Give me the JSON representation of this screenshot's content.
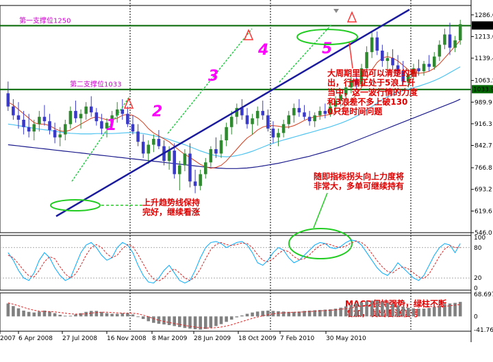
{
  "chart_data": {
    "type": "candlestick",
    "x_ticks": [
      "2007",
      "6 Apr 2008",
      "27 Jul 2008",
      "16 Nov 2008",
      "8 Mar 2009",
      "28 Jun 2009",
      "18 Oct 2009",
      "7 Feb 2010",
      "30 May 2010"
    ],
    "price_ticks": [
      "1286.6",
      "1213.0",
      "1139.4",
      "1063.5",
      "989.9",
      "916.3",
      "842.7",
      "766.8",
      "693.2",
      "619.6",
      "546.0"
    ],
    "price_range": [
      546.0,
      1300.0
    ],
    "current_price_tag": "1250.6",
    "support_price_tag": "1033.9",
    "support_lines": [
      {
        "label": "第一支撑位1250",
        "value": 1250
      },
      {
        "label": "第二支撑位1033",
        "value": 1033
      }
    ],
    "wave_labels": [
      "1",
      "2",
      "3",
      "4",
      "5"
    ],
    "series": [
      {
        "x": 0,
        "o": 1020,
        "h": 1060,
        "l": 960,
        "c": 975
      },
      {
        "x": 1,
        "o": 975,
        "h": 1000,
        "l": 930,
        "c": 945
      },
      {
        "x": 2,
        "o": 945,
        "h": 990,
        "l": 900,
        "c": 930
      },
      {
        "x": 3,
        "o": 930,
        "h": 960,
        "l": 880,
        "c": 905
      },
      {
        "x": 4,
        "o": 905,
        "h": 950,
        "l": 870,
        "c": 890
      },
      {
        "x": 5,
        "o": 890,
        "h": 930,
        "l": 860,
        "c": 915
      },
      {
        "x": 6,
        "o": 915,
        "h": 960,
        "l": 890,
        "c": 940
      },
      {
        "x": 7,
        "o": 940,
        "h": 980,
        "l": 910,
        "c": 925
      },
      {
        "x": 8,
        "o": 925,
        "h": 950,
        "l": 880,
        "c": 895
      },
      {
        "x": 9,
        "o": 895,
        "h": 920,
        "l": 850,
        "c": 870
      },
      {
        "x": 10,
        "o": 870,
        "h": 905,
        "l": 840,
        "c": 880
      },
      {
        "x": 11,
        "o": 880,
        "h": 930,
        "l": 860,
        "c": 915
      },
      {
        "x": 12,
        "o": 915,
        "h": 975,
        "l": 900,
        "c": 960
      },
      {
        "x": 13,
        "o": 960,
        "h": 995,
        "l": 920,
        "c": 935
      },
      {
        "x": 14,
        "o": 935,
        "h": 965,
        "l": 900,
        "c": 950
      },
      {
        "x": 15,
        "o": 950,
        "h": 990,
        "l": 930,
        "c": 975
      },
      {
        "x": 16,
        "o": 975,
        "h": 1010,
        "l": 940,
        "c": 955
      },
      {
        "x": 17,
        "o": 955,
        "h": 970,
        "l": 910,
        "c": 925
      },
      {
        "x": 18,
        "o": 925,
        "h": 950,
        "l": 880,
        "c": 900
      },
      {
        "x": 19,
        "o": 900,
        "h": 935,
        "l": 870,
        "c": 920
      },
      {
        "x": 20,
        "o": 920,
        "h": 960,
        "l": 900,
        "c": 945
      },
      {
        "x": 21,
        "o": 945,
        "h": 990,
        "l": 920,
        "c": 965
      },
      {
        "x": 22,
        "o": 965,
        "h": 1000,
        "l": 930,
        "c": 950
      },
      {
        "x": 23,
        "o": 950,
        "h": 975,
        "l": 905,
        "c": 915
      },
      {
        "x": 24,
        "o": 915,
        "h": 945,
        "l": 880,
        "c": 890
      },
      {
        "x": 25,
        "o": 890,
        "h": 915,
        "l": 840,
        "c": 855
      },
      {
        "x": 26,
        "o": 855,
        "h": 880,
        "l": 800,
        "c": 815
      },
      {
        "x": 27,
        "o": 815,
        "h": 860,
        "l": 780,
        "c": 845
      },
      {
        "x": 28,
        "o": 845,
        "h": 880,
        "l": 820,
        "c": 865
      },
      {
        "x": 29,
        "o": 865,
        "h": 895,
        "l": 830,
        "c": 840
      },
      {
        "x": 30,
        "o": 840,
        "h": 860,
        "l": 775,
        "c": 790
      },
      {
        "x": 31,
        "o": 790,
        "h": 840,
        "l": 760,
        "c": 825
      },
      {
        "x": 32,
        "o": 825,
        "h": 850,
        "l": 730,
        "c": 745
      },
      {
        "x": 33,
        "o": 745,
        "h": 790,
        "l": 690,
        "c": 775
      },
      {
        "x": 34,
        "o": 775,
        "h": 830,
        "l": 755,
        "c": 815
      },
      {
        "x": 35,
        "o": 815,
        "h": 850,
        "l": 700,
        "c": 720
      },
      {
        "x": 36,
        "o": 720,
        "h": 760,
        "l": 680,
        "c": 705
      },
      {
        "x": 37,
        "o": 705,
        "h": 760,
        "l": 690,
        "c": 745
      },
      {
        "x": 38,
        "o": 745,
        "h": 800,
        "l": 730,
        "c": 785
      },
      {
        "x": 39,
        "o": 785,
        "h": 840,
        "l": 770,
        "c": 830
      },
      {
        "x": 40,
        "o": 830,
        "h": 870,
        "l": 800,
        "c": 815
      },
      {
        "x": 41,
        "o": 815,
        "h": 880,
        "l": 800,
        "c": 860
      },
      {
        "x": 42,
        "o": 860,
        "h": 920,
        "l": 840,
        "c": 905
      },
      {
        "x": 43,
        "o": 905,
        "h": 960,
        "l": 880,
        "c": 940
      },
      {
        "x": 44,
        "o": 940,
        "h": 985,
        "l": 915,
        "c": 970
      },
      {
        "x": 45,
        "o": 970,
        "h": 1000,
        "l": 930,
        "c": 945
      },
      {
        "x": 46,
        "o": 945,
        "h": 970,
        "l": 900,
        "c": 915
      },
      {
        "x": 47,
        "o": 915,
        "h": 950,
        "l": 880,
        "c": 935
      },
      {
        "x": 48,
        "o": 935,
        "h": 975,
        "l": 910,
        "c": 960
      },
      {
        "x": 49,
        "o": 960,
        "h": 995,
        "l": 930,
        "c": 945
      },
      {
        "x": 50,
        "o": 945,
        "h": 965,
        "l": 890,
        "c": 900
      },
      {
        "x": 51,
        "o": 900,
        "h": 925,
        "l": 850,
        "c": 870
      },
      {
        "x": 52,
        "o": 870,
        "h": 900,
        "l": 840,
        "c": 885
      },
      {
        "x": 53,
        "o": 885,
        "h": 930,
        "l": 870,
        "c": 915
      },
      {
        "x": 54,
        "o": 915,
        "h": 960,
        "l": 900,
        "c": 945
      },
      {
        "x": 55,
        "o": 945,
        "h": 985,
        "l": 920,
        "c": 970
      },
      {
        "x": 56,
        "o": 970,
        "h": 1000,
        "l": 940,
        "c": 955
      },
      {
        "x": 57,
        "o": 955,
        "h": 980,
        "l": 930,
        "c": 940
      },
      {
        "x": 58,
        "o": 940,
        "h": 960,
        "l": 910,
        "c": 925
      },
      {
        "x": 59,
        "o": 925,
        "h": 955,
        "l": 905,
        "c": 945
      },
      {
        "x": 60,
        "o": 945,
        "h": 975,
        "l": 930,
        "c": 960
      },
      {
        "x": 61,
        "o": 960,
        "h": 985,
        "l": 935,
        "c": 950
      },
      {
        "x": 62,
        "o": 950,
        "h": 990,
        "l": 940,
        "c": 975
      },
      {
        "x": 63,
        "o": 975,
        "h": 1010,
        "l": 955,
        "c": 995
      },
      {
        "x": 64,
        "o": 995,
        "h": 1030,
        "l": 975,
        "c": 1015
      },
      {
        "x": 65,
        "o": 1015,
        "h": 1050,
        "l": 995,
        "c": 1040
      },
      {
        "x": 66,
        "o": 1040,
        "h": 1080,
        "l": 1020,
        "c": 1065
      },
      {
        "x": 67,
        "o": 1065,
        "h": 1090,
        "l": 1030,
        "c": 1050
      },
      {
        "x": 68,
        "o": 1050,
        "h": 1120,
        "l": 1040,
        "c": 1105
      },
      {
        "x": 69,
        "o": 1105,
        "h": 1180,
        "l": 1090,
        "c": 1160
      },
      {
        "x": 70,
        "o": 1160,
        "h": 1230,
        "l": 1140,
        "c": 1210
      },
      {
        "x": 71,
        "o": 1210,
        "h": 1230,
        "l": 1150,
        "c": 1165
      },
      {
        "x": 72,
        "o": 1165,
        "h": 1185,
        "l": 1110,
        "c": 1130
      },
      {
        "x": 73,
        "o": 1130,
        "h": 1160,
        "l": 1090,
        "c": 1140
      },
      {
        "x": 74,
        "o": 1140,
        "h": 1170,
        "l": 1100,
        "c": 1115
      },
      {
        "x": 75,
        "o": 1115,
        "h": 1150,
        "l": 1080,
        "c": 1095
      },
      {
        "x": 76,
        "o": 1095,
        "h": 1130,
        "l": 1050,
        "c": 1060
      },
      {
        "x": 77,
        "o": 1060,
        "h": 1100,
        "l": 1040,
        "c": 1085
      },
      {
        "x": 78,
        "o": 1085,
        "h": 1120,
        "l": 1065,
        "c": 1105
      },
      {
        "x": 79,
        "o": 1105,
        "h": 1135,
        "l": 1080,
        "c": 1095
      },
      {
        "x": 80,
        "o": 1095,
        "h": 1130,
        "l": 1080,
        "c": 1120
      },
      {
        "x": 81,
        "o": 1120,
        "h": 1150,
        "l": 1095,
        "c": 1110
      },
      {
        "x": 82,
        "o": 1110,
        "h": 1160,
        "l": 1100,
        "c": 1145
      },
      {
        "x": 83,
        "o": 1145,
        "h": 1200,
        "l": 1130,
        "c": 1185
      },
      {
        "x": 84,
        "o": 1185,
        "h": 1240,
        "l": 1170,
        "c": 1220
      },
      {
        "x": 85,
        "o": 1220,
        "h": 1260,
        "l": 1150,
        "c": 1175
      },
      {
        "x": 86,
        "o": 1175,
        "h": 1215,
        "l": 1160,
        "c": 1200
      },
      {
        "x": 87,
        "o": 1200,
        "h": 1270,
        "l": 1185,
        "c": 1255
      }
    ],
    "ma_short": [
      990,
      980,
      965,
      950,
      935,
      920,
      915,
      915,
      910,
      900,
      892,
      890,
      895,
      905,
      915,
      925,
      935,
      940,
      935,
      930,
      930,
      935,
      945,
      948,
      945,
      935,
      920,
      900,
      885,
      875,
      865,
      855,
      840,
      825,
      812,
      802,
      790,
      778,
      770,
      765,
      768,
      775,
      790,
      810,
      830,
      850,
      868,
      880,
      895,
      905,
      910,
      910,
      908,
      905,
      905,
      910,
      918,
      928,
      935,
      940,
      942,
      945,
      948,
      955,
      965,
      978,
      995,
      1015,
      1040,
      1070,
      1100,
      1125,
      1140,
      1145,
      1140,
      1130,
      1115,
      1100,
      1090,
      1088,
      1090,
      1095,
      1105,
      1120,
      1140,
      1160,
      1180,
      1200
    ],
    "ma_mid": [
      915,
      913,
      910,
      907,
      904,
      901,
      898,
      896,
      894,
      891,
      888,
      886,
      884,
      883,
      882,
      882,
      882,
      883,
      883,
      883,
      883,
      884,
      885,
      886,
      886,
      885,
      883,
      880,
      876,
      872,
      868,
      863,
      857,
      851,
      845,
      838,
      831,
      824,
      818,
      812,
      808,
      805,
      804,
      805,
      808,
      812,
      817,
      823,
      830,
      837,
      844,
      850,
      856,
      861,
      866,
      871,
      876,
      881,
      886,
      891,
      896,
      901,
      906,
      912,
      918,
      925,
      933,
      942,
      952,
      963,
      975,
      987,
      998,
      1008,
      1016,
      1023,
      1029,
      1034,
      1039,
      1044,
      1050,
      1056,
      1063,
      1071,
      1080,
      1090,
      1100,
      1110
    ],
    "ma_long": [
      845,
      843,
      841,
      839,
      837,
      835,
      833,
      831,
      829,
      827,
      825,
      823,
      821,
      819,
      817,
      815,
      813,
      811,
      809,
      807,
      805,
      803,
      801,
      799,
      797,
      795,
      793,
      791,
      789,
      787,
      785,
      783,
      781,
      779,
      777,
      775,
      773,
      771,
      769,
      767,
      766,
      765,
      764,
      764,
      764,
      765,
      766,
      768,
      770,
      773,
      776,
      779,
      782,
      786,
      790,
      794,
      798,
      802,
      806,
      811,
      816,
      821,
      826,
      832,
      838,
      845,
      852,
      859,
      866,
      873,
      880,
      887,
      894,
      901,
      908,
      915,
      922,
      929,
      936,
      943,
      950,
      957,
      964,
      971,
      978,
      985,
      992,
      1000
    ],
    "stoch_ticks": [
      "100",
      "80",
      "20",
      "0"
    ],
    "stoch_k": [
      70,
      55,
      35,
      20,
      15,
      30,
      55,
      70,
      60,
      40,
      25,
      15,
      20,
      45,
      70,
      85,
      90,
      80,
      65,
      55,
      60,
      80,
      90,
      85,
      70,
      45,
      25,
      12,
      10,
      20,
      35,
      45,
      30,
      15,
      10,
      15,
      35,
      60,
      80,
      90,
      92,
      88,
      80,
      85,
      90,
      92,
      85,
      70,
      50,
      45,
      55,
      70,
      80,
      75,
      60,
      50,
      55,
      65,
      75,
      85,
      90,
      88,
      80,
      78,
      82,
      90,
      95,
      93,
      85,
      70,
      55,
      40,
      30,
      25,
      35,
      50,
      40,
      30,
      20,
      15,
      25,
      45,
      65,
      80,
      88,
      85,
      70,
      88
    ],
    "stoch_d": [
      65,
      60,
      48,
      35,
      24,
      22,
      35,
      52,
      62,
      58,
      42,
      28,
      20,
      28,
      45,
      65,
      80,
      86,
      80,
      68,
      60,
      65,
      78,
      86,
      82,
      66,
      48,
      30,
      18,
      14,
      20,
      32,
      38,
      30,
      20,
      15,
      22,
      38,
      58,
      76,
      86,
      90,
      86,
      84,
      86,
      89,
      88,
      80,
      66,
      55,
      52,
      58,
      68,
      75,
      72,
      62,
      56,
      58,
      66,
      76,
      84,
      88,
      86,
      82,
      80,
      83,
      89,
      93,
      90,
      82,
      68,
      54,
      42,
      33,
      30,
      38,
      42,
      38,
      30,
      22,
      19,
      28,
      45,
      63,
      77,
      84,
      80,
      80
    ],
    "macd_ticks": [
      "68.697",
      "0",
      "-41.762"
    ],
    "macd_hist": [
      40,
      32,
      25,
      18,
      14,
      12,
      15,
      18,
      15,
      10,
      5,
      2,
      2,
      6,
      10,
      14,
      17,
      17,
      14,
      10,
      8,
      8,
      10,
      10,
      6,
      0,
      -8,
      -15,
      -20,
      -23,
      -25,
      -27,
      -30,
      -33,
      -36,
      -38,
      -40,
      -41,
      -39,
      -35,
      -30,
      -24,
      -17,
      -10,
      -3,
      3,
      8,
      12,
      15,
      17,
      18,
      17,
      16,
      15,
      14,
      14,
      15,
      17,
      18,
      19,
      20,
      21,
      22,
      24,
      27,
      31,
      36,
      40,
      44,
      47,
      49,
      49,
      46,
      42,
      38,
      34,
      30,
      27,
      25,
      24,
      24,
      26,
      29,
      33,
      37,
      40,
      42,
      45
    ],
    "macd_signal": [
      42,
      38,
      33,
      28,
      23,
      19,
      16,
      15,
      15,
      14,
      12,
      10,
      8,
      7,
      7,
      8,
      10,
      12,
      13,
      13,
      12,
      11,
      10,
      10,
      10,
      8,
      4,
      -1,
      -7,
      -12,
      -16,
      -19,
      -22,
      -25,
      -28,
      -31,
      -33,
      -35,
      -36,
      -36,
      -35,
      -33,
      -30,
      -26,
      -21,
      -16,
      -11,
      -6,
      -2,
      2,
      5,
      8,
      10,
      11,
      12,
      13,
      13,
      14,
      15,
      16,
      17,
      18,
      19,
      20,
      22,
      24,
      26,
      29,
      32,
      35,
      38,
      41,
      43,
      43,
      43,
      42,
      40,
      38,
      36,
      34,
      32,
      31,
      30,
      30,
      31,
      33,
      35,
      37
    ],
    "annotations": [
      "大周期里面可以清楚的看出，行情正处于5浪上升当中，这一波行情的力度和3浪差不多上破1300只是时间问题",
      "随即指标拐头向上力度将非常大，多单可继续持有",
      "上升趋势线保持完好，继续看涨",
      "MACD保持强势，绿柱不断增加，发出看涨信号"
    ],
    "colors": {
      "bull": "#2f8a2f",
      "bear": "#3a3ac8",
      "ma_short": "#d43b1a",
      "ma_mid": "#4fc3f0",
      "ma_long": "#1a1a8c",
      "trendline": "#1a1a9c",
      "support": "#006600",
      "wave_line": "#22cc44",
      "ellipse": "#22cc22",
      "annotation": "#e00000",
      "stoch_k": "#00aaff",
      "stoch_d": "#dd2222",
      "macd_hist": "#808080",
      "macd_signal": "#dd2222"
    }
  }
}
